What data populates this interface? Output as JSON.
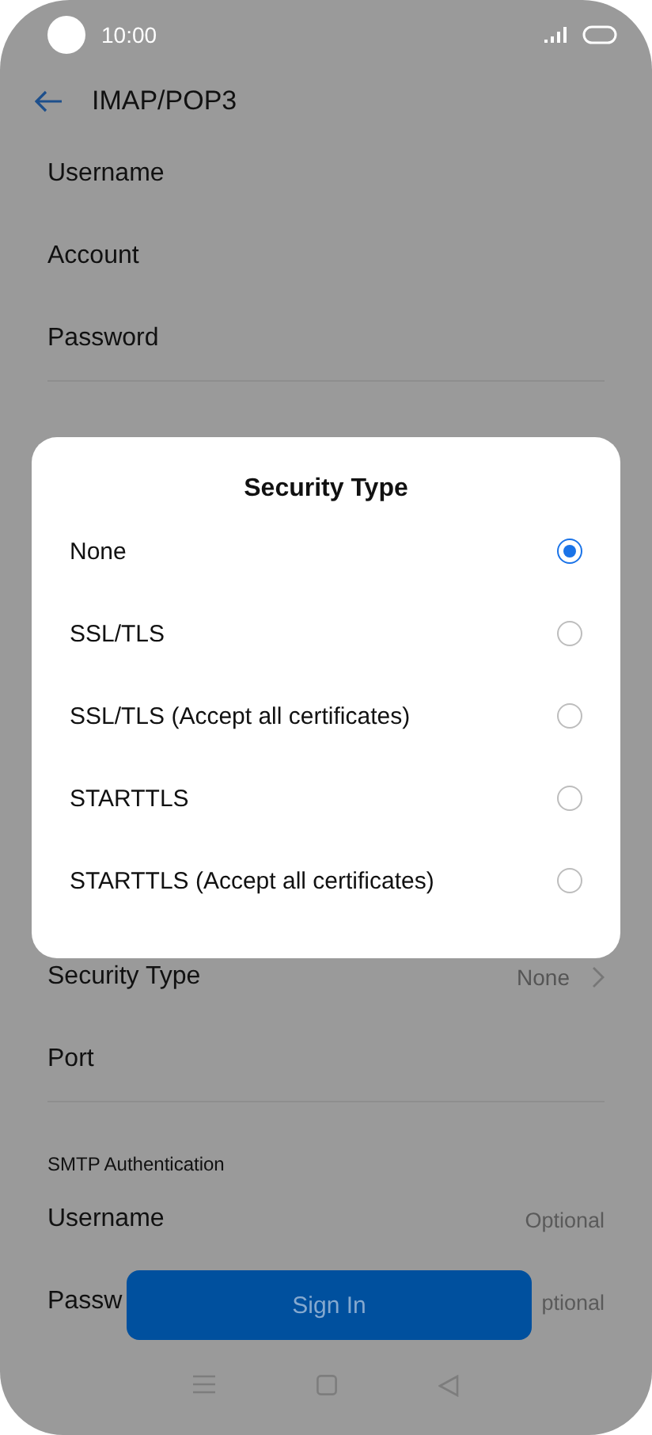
{
  "status_bar": {
    "time": "10:00"
  },
  "header": {
    "title": "IMAP/POP3"
  },
  "fields": [
    {
      "label": "Username"
    },
    {
      "label": "Account"
    },
    {
      "label": "Password"
    }
  ],
  "lower_fields": [
    {
      "label": "Security Type",
      "value": "None",
      "kind": "select"
    },
    {
      "label": "Port",
      "kind": "text"
    }
  ],
  "smtp_section": {
    "heading": "SMTP Authentication",
    "fields": [
      {
        "label": "Username",
        "placeholder": "Optional"
      },
      {
        "label": "Passw",
        "placeholder": "ptional"
      }
    ]
  },
  "dialog": {
    "title": "Security Type",
    "options": [
      {
        "label": "None",
        "selected": true
      },
      {
        "label": "SSL/TLS",
        "selected": false
      },
      {
        "label": "SSL/TLS (Accept all certificates)",
        "selected": false
      },
      {
        "label": "STARTTLS",
        "selected": false
      },
      {
        "label": "STARTTLS (Accept all certificates)",
        "selected": false
      }
    ]
  },
  "sign_in_button": {
    "label": "Sign In"
  }
}
